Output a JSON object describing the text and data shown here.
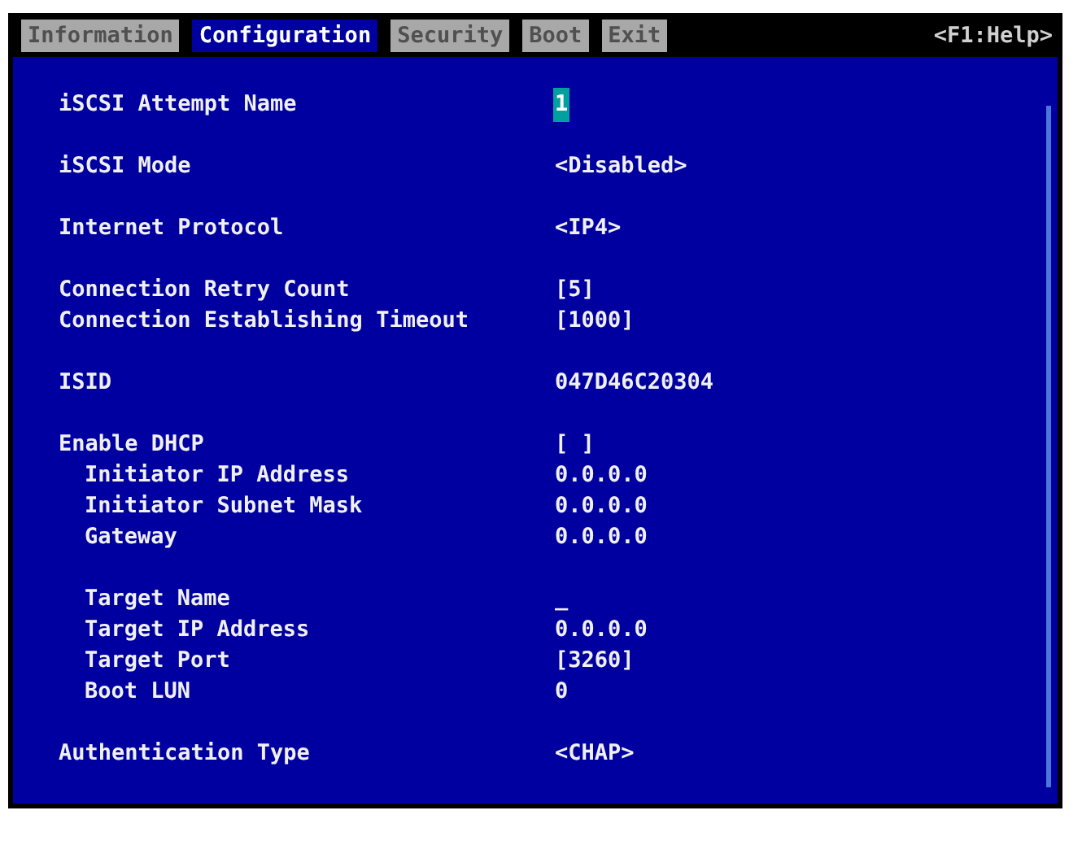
{
  "menu": {
    "tabs": [
      {
        "label": "Information",
        "selected": false
      },
      {
        "label": "Configuration",
        "selected": true
      },
      {
        "label": "Security",
        "selected": false
      },
      {
        "label": "Boot",
        "selected": false
      },
      {
        "label": "Exit",
        "selected": false
      }
    ],
    "help": "<F1:Help>"
  },
  "groups": [
    {
      "rows": [
        {
          "kind": "top",
          "label": "iSCSI Attempt Name",
          "value": "1",
          "selected": true
        }
      ]
    },
    {
      "rows": [
        {
          "kind": "top",
          "label": "iSCSI Mode",
          "value": "<Disabled>",
          "selected": false
        }
      ]
    },
    {
      "rows": [
        {
          "kind": "top",
          "label": "Internet Protocol",
          "value": "<IP4>",
          "selected": false
        }
      ]
    },
    {
      "rows": [
        {
          "kind": "top",
          "label": "Connection Retry Count",
          "value": "[5]",
          "selected": false
        },
        {
          "kind": "top",
          "label": "Connection Establishing Timeout",
          "value": "[1000]",
          "selected": false
        }
      ]
    },
    {
      "rows": [
        {
          "kind": "top",
          "label": "ISID",
          "value": "047D46C20304",
          "selected": false
        }
      ]
    },
    {
      "rows": [
        {
          "kind": "top",
          "label": "Enable DHCP",
          "value": "[ ]",
          "selected": false
        },
        {
          "kind": "sub",
          "label": "Initiator IP Address",
          "value": "0.0.0.0",
          "selected": false
        },
        {
          "kind": "sub",
          "label": "Initiator Subnet Mask",
          "value": "0.0.0.0",
          "selected": false
        },
        {
          "kind": "sub",
          "label": "Gateway",
          "value": "0.0.0.0",
          "selected": false
        }
      ]
    },
    {
      "rows": [
        {
          "kind": "sub",
          "label": "Target Name",
          "value": "_",
          "selected": false
        },
        {
          "kind": "sub",
          "label": "Target IP Address",
          "value": "0.0.0.0",
          "selected": false
        },
        {
          "kind": "sub",
          "label": "Target Port",
          "value": "[3260]",
          "selected": false
        },
        {
          "kind": "sub",
          "label": "Boot LUN",
          "value": "0",
          "selected": false
        }
      ]
    },
    {
      "rows": [
        {
          "kind": "top",
          "label": "Authentication Type",
          "value": "<CHAP>",
          "selected": false
        }
      ]
    }
  ]
}
